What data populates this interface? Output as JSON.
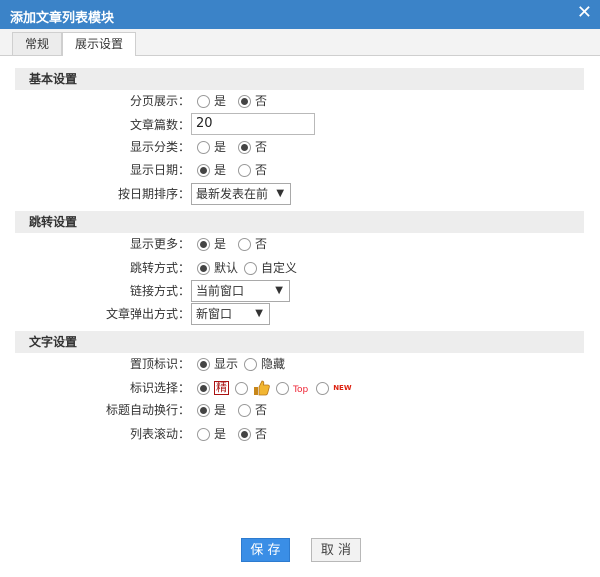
{
  "window": {
    "title": "添加文章列表模块",
    "close_glyph": "✕"
  },
  "tabs": [
    {
      "label": "常规"
    },
    {
      "label": "展示设置"
    }
  ],
  "sections": {
    "basic": "基本设置",
    "jump": "跳转设置",
    "text": "文字设置"
  },
  "fields": {
    "paging": {
      "label": "分页展示：",
      "options": [
        "是",
        "否"
      ],
      "selected": "否"
    },
    "count": {
      "label": "文章篇数：",
      "value": "20"
    },
    "show_category": {
      "label": "显示分类：",
      "options": [
        "是",
        "否"
      ],
      "selected": "否"
    },
    "show_date": {
      "label": "显示日期：",
      "options": [
        "是",
        "否"
      ],
      "selected": "是"
    },
    "sort": {
      "label": "按日期排序：",
      "value": "最新发表在前"
    },
    "show_more": {
      "label": "显示更多：",
      "options": [
        "是",
        "否"
      ],
      "selected": "是"
    },
    "jump_mode": {
      "label": "跳转方式：",
      "options": [
        "默认",
        "自定义"
      ],
      "selected": "默认"
    },
    "link_mode": {
      "label": "链接方式：",
      "value": "当前窗口"
    },
    "popup_mode": {
      "label": "文章弹出方式：",
      "value": "新窗口"
    },
    "top_mark": {
      "label": "置顶标识：",
      "options": [
        "显示",
        "隐藏"
      ],
      "selected": "显示"
    },
    "mark_select": {
      "label": "标识选择：",
      "tags": [
        "精",
        "thumb",
        "Top",
        "NEW"
      ],
      "selected": "精"
    },
    "title_wrap": {
      "label": "标题自动换行：",
      "options": [
        "是",
        "否"
      ],
      "selected": "是"
    },
    "list_scroll": {
      "label": "列表滚动：",
      "options": [
        "是",
        "否"
      ],
      "selected": "否"
    }
  },
  "buttons": {
    "save": "保 存",
    "cancel": "取 消"
  },
  "colors": {
    "titlebar": "#3b83c8",
    "save": "#3a8ee6"
  }
}
